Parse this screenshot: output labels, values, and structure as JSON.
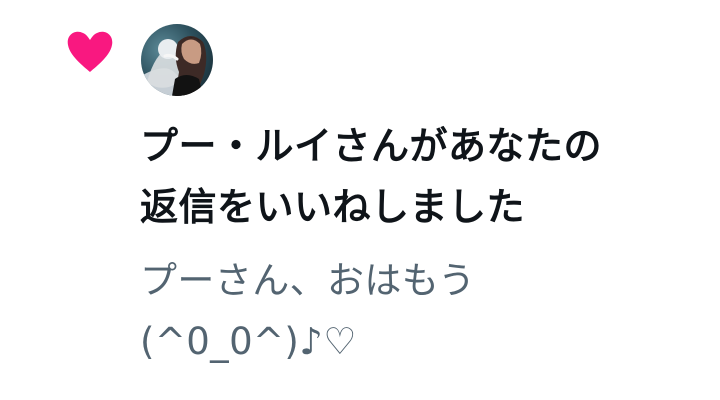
{
  "notification": {
    "icon": "heart-icon",
    "accent_color": "#f91880",
    "avatar": "user-avatar",
    "message_lines": [
      "プー・ルイさんがあなたの",
      "返信をいいねしました"
    ],
    "reply_lines": [
      "プーさん、おはもう",
      "(^0_0^)♪♡"
    ]
  }
}
